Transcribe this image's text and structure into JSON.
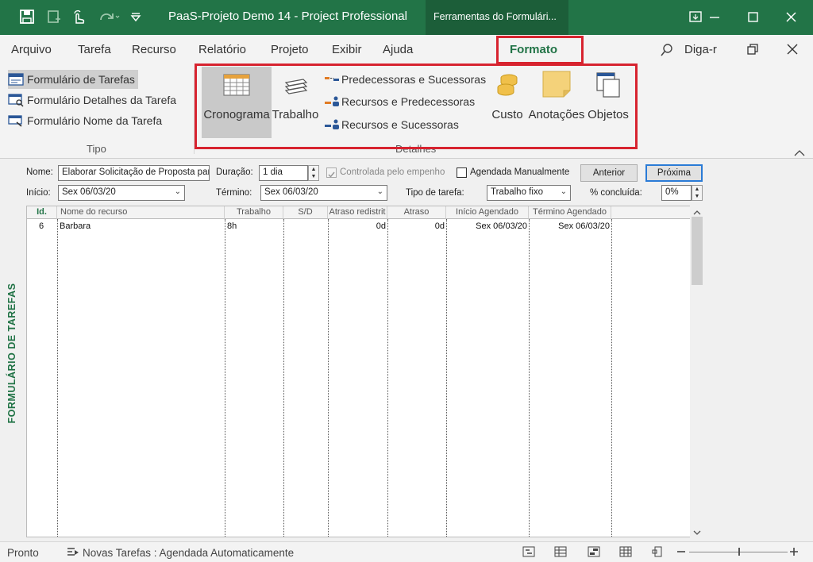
{
  "titlebar": {
    "title": "PaaS-Projeto Demo 14  -  Project Professional",
    "context_tab": "Ferramentas do Formulári...",
    "icons": [
      "save-icon",
      "new-from-template-icon",
      "touch-mode-icon",
      "redo-icon",
      "customize-quick-access-icon"
    ],
    "window_buttons": [
      "ribbon-display-options-icon",
      "minimize-icon",
      "maximize-icon",
      "close-icon"
    ]
  },
  "tabs": [
    "Arquivo",
    "Tarefa",
    "Recurso",
    "Relatório",
    "Projeto",
    "Exibir",
    "Ajuda",
    "Formato"
  ],
  "active_tab": "Formato",
  "tell_me": "Diga-r",
  "ribbon": {
    "tipo": {
      "items": [
        "Formulário de Tarefas",
        "Formulário Detalhes da Tarefa",
        "Formulário Nome da Tarefa"
      ],
      "label": "Tipo"
    },
    "detalhes": {
      "cronograma": "Cronograma",
      "trabalho": "Trabalho",
      "pred_suc": "Predecessoras e Sucessoras",
      "rec_pred": "Recursos e Predecessoras",
      "rec_suc": "Recursos e Sucessoras",
      "custo": "Custo",
      "anotacoes": "Anotações",
      "objetos": "Objetos",
      "label": "Detalhes"
    }
  },
  "form": {
    "side_title": "FORMULÁRIO DE TAREFAS",
    "nome_label": "Nome:",
    "nome_value": "Elaborar Solicitação de Proposta par",
    "duracao_label": "Duração:",
    "duracao_value": "1 dia",
    "controlada_label": "Controlada pelo empenho",
    "agendada_label": "Agendada Manualmente",
    "anterior": "Anterior",
    "proxima": "Próxima",
    "inicio_label": "Início:",
    "inicio_value": "Sex 06/03/20",
    "termino_label": "Término:",
    "termino_value": "Sex 06/03/20",
    "tipo_label": "Tipo de tarefa:",
    "tipo_value": "Trabalho fixo",
    "concluida_label": "% concluída:",
    "concluida_value": "0%"
  },
  "grid": {
    "headers": [
      "Id.",
      "Nome do recurso",
      "Trabalho",
      "S/D",
      "Atraso redistrit",
      "Atraso",
      "Início Agendado",
      "Término Agendado"
    ],
    "rows": [
      [
        "6",
        "Barbara",
        "8h",
        "",
        "0d",
        "0d",
        "Sex 06/03/20",
        "Sex 06/03/20"
      ]
    ]
  },
  "status": {
    "ready": "Pronto",
    "new_tasks": "Novas Tarefas : Agendada Automaticamente"
  }
}
